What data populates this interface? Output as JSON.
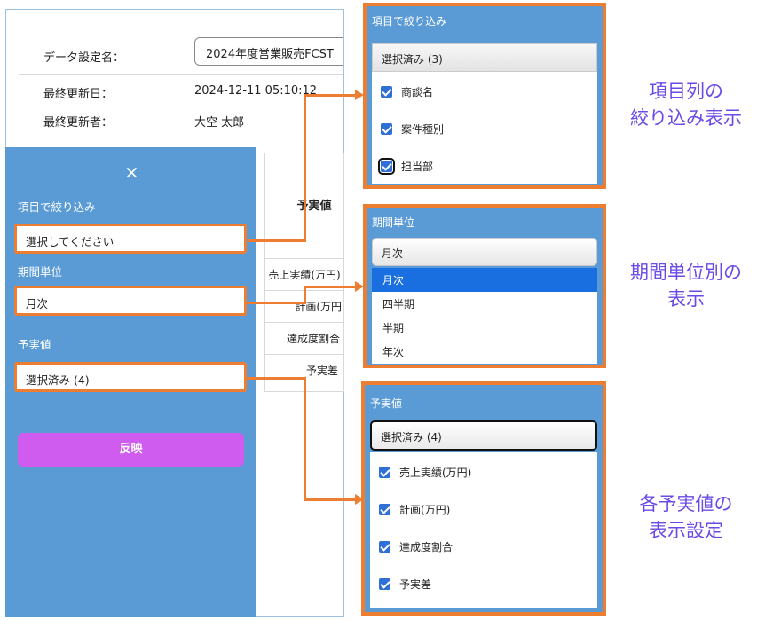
{
  "meta": {
    "dataset_label": "データ設定名：",
    "dataset_value": "2024年度営業販売FCST",
    "updated_date_label": "最終更新日：",
    "updated_date_value": "2024-12-11 05:10:12",
    "updated_by_label": "最終更新者：",
    "updated_by_value": "大空 太郎"
  },
  "panel": {
    "close": "×",
    "filter_label": "項目で絞り込み",
    "filter_value": "選択してください",
    "period_label": "期間単位",
    "period_value": "月次",
    "measures_label": "予実値",
    "measures_value": "選択済み (4)",
    "apply_label": "反映"
  },
  "table": {
    "header": "予実値",
    "rows": [
      "売上実績(万円)",
      "計画(万円)",
      "達成度割合",
      "予実差"
    ]
  },
  "callout_filter": {
    "title": "項目で絞り込み",
    "selected": "選択済み (3)",
    "options": [
      "商談名",
      "案件種別",
      "担当部"
    ]
  },
  "callout_period": {
    "title": "期間単位",
    "selected": "月次",
    "options": [
      "月次",
      "四半期",
      "半期",
      "年次"
    ]
  },
  "callout_measures": {
    "title": "予実値",
    "selected": "選択済み (4)",
    "options": [
      "売上実績(万円)",
      "計画(万円)",
      "達成度割合",
      "予実差"
    ]
  },
  "captions": {
    "filter": [
      "項目列の",
      "絞り込み表示"
    ],
    "period": [
      "期間単位別の",
      "表示"
    ],
    "measures": [
      "各予実値の",
      "表示設定"
    ]
  },
  "colors": {
    "panel_blue": "#5b9bd5",
    "highlight_orange": "#ed7d31",
    "apply_magenta": "#cf5cef",
    "caption_purple": "#6a4be6",
    "checkbox_blue": "#2f6fd6"
  }
}
